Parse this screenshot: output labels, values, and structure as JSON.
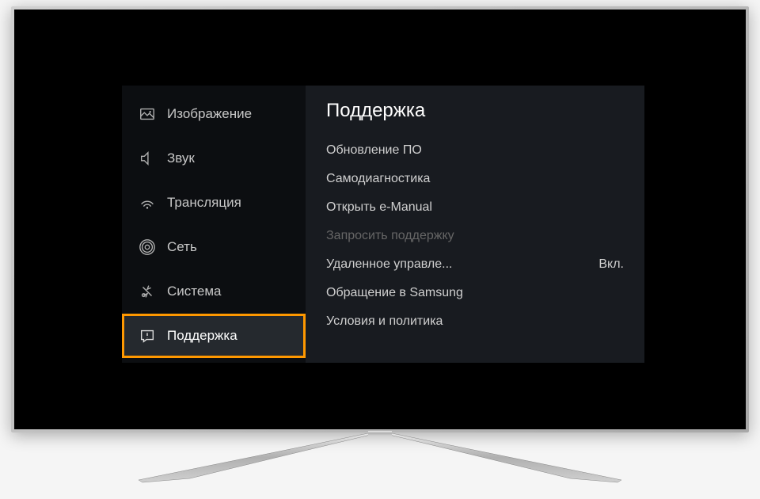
{
  "sidebar": {
    "items": [
      {
        "label": "Изображение",
        "icon": "picture-icon"
      },
      {
        "label": "Звук",
        "icon": "sound-icon"
      },
      {
        "label": "Трансляция",
        "icon": "broadcast-icon"
      },
      {
        "label": "Сеть",
        "icon": "network-icon"
      },
      {
        "label": "Система",
        "icon": "system-icon"
      },
      {
        "label": "Поддержка",
        "icon": "support-icon",
        "selected": true
      }
    ]
  },
  "content": {
    "title": "Поддержка",
    "items": [
      {
        "label": "Обновление ПО"
      },
      {
        "label": "Самодиагностика"
      },
      {
        "label": "Открыть e-Manual"
      },
      {
        "label": "Запросить поддержку",
        "disabled": true
      },
      {
        "label": "Удаленное управле...",
        "value": "Вкл."
      },
      {
        "label": "Обращение в Samsung"
      },
      {
        "label": "Условия и политика"
      }
    ]
  },
  "colors": {
    "highlight": "#ff9800",
    "screen_bg": "#000000",
    "panel_bg": "#1c2026"
  }
}
